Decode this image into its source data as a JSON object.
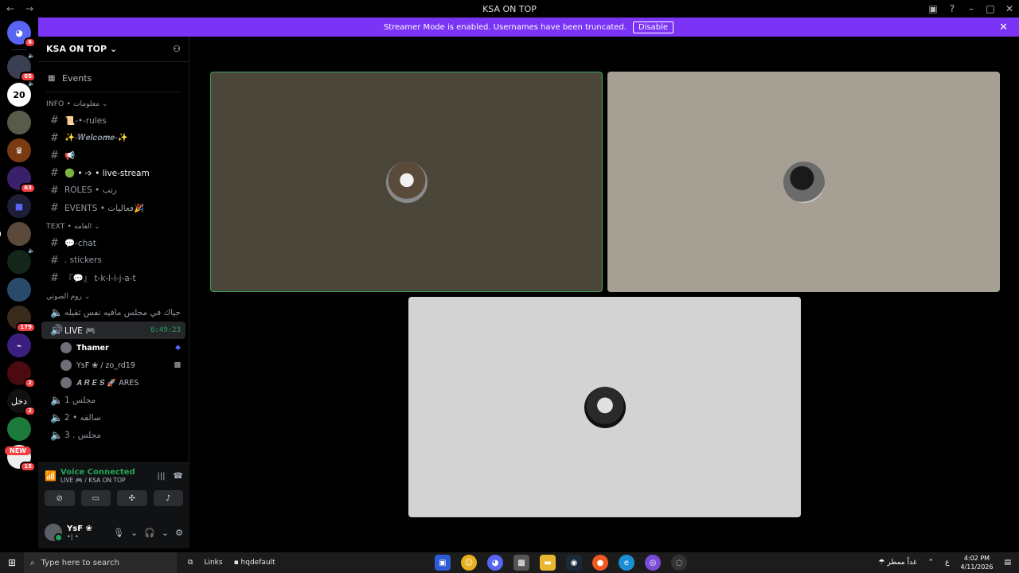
{
  "window": {
    "title": "KSA ON TOP"
  },
  "banner": {
    "text": "Streamer Mode is enabled. Usernames have been truncated.",
    "disable_label": "Disable"
  },
  "guilds": [
    {
      "label": "",
      "badge": "6"
    },
    {
      "label": "",
      "badge": "65"
    },
    {
      "label": "20",
      "badge": ""
    },
    {
      "label": "",
      "badge": ""
    },
    {
      "label": "",
      "badge": ""
    },
    {
      "label": "",
      "badge": "63"
    },
    {
      "label": "",
      "badge": ""
    },
    {
      "label": "",
      "badge": ""
    },
    {
      "label": "",
      "badge": ""
    },
    {
      "label": "",
      "badge": ""
    },
    {
      "label": "",
      "badge": "179"
    },
    {
      "label": "",
      "badge": ""
    },
    {
      "label": "",
      "badge": "2"
    },
    {
      "label": "دخل",
      "badge": "2"
    },
    {
      "label": "",
      "badge": ""
    },
    {
      "label": "",
      "badge": "15"
    }
  ],
  "new_badge": "NEW",
  "server": {
    "name": "KSA ON TOP",
    "events_label": "Events"
  },
  "categories": {
    "info": "INFO • معلومات",
    "text": "TEXT • العامه",
    "voice": "روم الصوتي"
  },
  "info_channels": [
    {
      "name": "📜-•-rules"
    },
    {
      "name": "✨-𝑾𝒆𝒍𝒄𝒐𝒎𝒆-✨"
    },
    {
      "name": "📢"
    },
    {
      "name": "🟢 • ➩ • live-stream"
    },
    {
      "name": "ROLES • رتب"
    },
    {
      "name": "EVENTS • فعاليات🎉"
    }
  ],
  "text_channels": [
    {
      "name": "💬-chat"
    },
    {
      "name": ". stickers"
    },
    {
      "name": "『💬』 t-k-l-i-j-a-t"
    }
  ],
  "voice_channels": {
    "first": "حياك في مجلس مافيه نفس ثقيله",
    "live": {
      "name": "LIVE 🎮",
      "timer": "6:49:23"
    },
    "users": [
      {
        "name": "Thamer"
      },
      {
        "name": "YsF ❀ / zo_rd19"
      },
      {
        "name": "𝑨 𝑹 𝑬 𝑺 🚀 ARES"
      }
    ],
    "rest": [
      "مجلس 1",
      "سالفه • 2",
      "مجلس . 3"
    ]
  },
  "voice_panel": {
    "title": "Voice Connected",
    "subtitle": "LIVE 🎮 / KSA ON TOP"
  },
  "user_panel": {
    "name": "YsF ❀",
    "status": "•| •"
  },
  "taskbar": {
    "search_placeholder": "Type here to search",
    "links_label": "Links",
    "hq_label": "hqdefault",
    "weather": "غداً ممطر",
    "lang": "ع",
    "time": "4:02 PM",
    "date": "4/11/2026"
  },
  "colors": {
    "accent": "#7b33f5",
    "voice_green": "#23a55a",
    "unread_red": "#f23f42"
  }
}
